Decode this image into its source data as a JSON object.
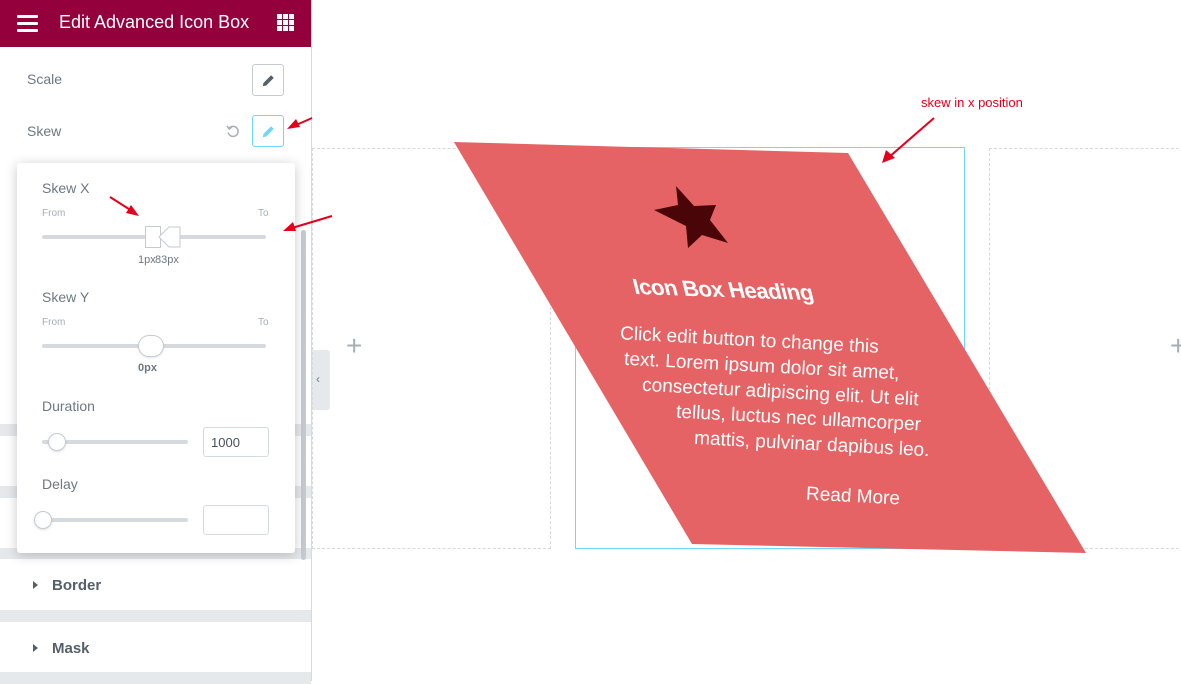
{
  "header": {
    "title": "Edit Advanced Icon Box"
  },
  "controls": {
    "scale_label": "Scale",
    "skew_label": "Skew"
  },
  "popup": {
    "skew_x": {
      "label": "Skew X",
      "from": "From",
      "to": "To",
      "from_value": "1px",
      "to_value": "83px"
    },
    "skew_y": {
      "label": "Skew Y",
      "from": "From",
      "to": "To",
      "value": "0px"
    },
    "duration": {
      "label": "Duration",
      "value": "1000"
    },
    "delay": {
      "label": "Delay",
      "value": ""
    }
  },
  "sections": [
    {
      "title": "Border"
    },
    {
      "title": "Mask"
    }
  ],
  "preview": {
    "heading": "Icon Box Heading",
    "body_lines": [
      "Click edit button to change this",
      "text. Lorem ipsum dolor sit amet,",
      "consectetur adipiscing elit. Ut elit",
      "tellus, luctus nec ullamcorper",
      "mattis, pulvinar dapibus leo."
    ],
    "read_more": "Read More",
    "box_color": "#e56364",
    "icon_color": "#4a0508"
  },
  "annotation": {
    "text": "skew in x position"
  },
  "colors": {
    "brand": "#93003c",
    "accent": "#71d7f7",
    "annotation": "#e2001a"
  }
}
